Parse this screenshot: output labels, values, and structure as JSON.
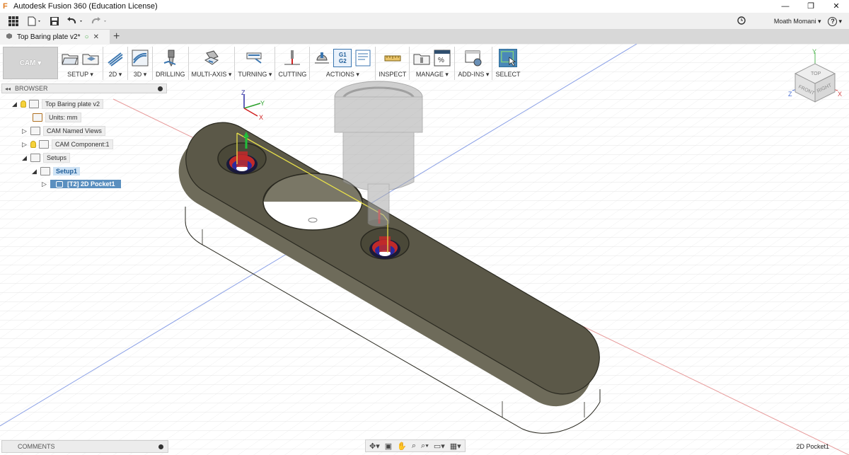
{
  "window": {
    "title": "Autodesk Fusion 360 (Education License)",
    "minimize": "—",
    "restore": "❐",
    "close": "✕"
  },
  "quick_access": {
    "user": "Moath Momani",
    "help": "?"
  },
  "document_tab": {
    "title": "Top Baring plate v2*"
  },
  "workspace": {
    "label": "CAM ▾"
  },
  "ribbon_groups": [
    {
      "id": "setup",
      "label": "SETUP ▾"
    },
    {
      "id": "2d",
      "label": "2D ▾"
    },
    {
      "id": "3d",
      "label": "3D ▾"
    },
    {
      "id": "drilling",
      "label": "DRILLING"
    },
    {
      "id": "multiaxis",
      "label": "MULTI-AXIS ▾"
    },
    {
      "id": "turning",
      "label": "TURNING ▾"
    },
    {
      "id": "cutting",
      "label": "CUTTING"
    },
    {
      "id": "actions",
      "label": "ACTIONS ▾"
    },
    {
      "id": "inspect",
      "label": "INSPECT"
    },
    {
      "id": "manage",
      "label": "MANAGE ▾"
    },
    {
      "id": "addins",
      "label": "ADD-INS ▾"
    },
    {
      "id": "select",
      "label": "SELECT"
    }
  ],
  "actions_g_code": {
    "line1": "G1",
    "line2": "G2"
  },
  "browser": {
    "header": "BROWSER",
    "items": [
      {
        "label": "Top Baring plate v2"
      },
      {
        "label": "Units: mm"
      },
      {
        "label": "CAM Named Views"
      },
      {
        "label": "CAM Component:1"
      },
      {
        "label": "Setups"
      },
      {
        "label": "Setup1"
      },
      {
        "label": "[T2] 2D Pocket1"
      }
    ]
  },
  "triad": {
    "x": "X",
    "y": "Y",
    "z": "Z"
  },
  "viewcube": {
    "top": "TOP",
    "front": "FRONT",
    "right": "RIGHT",
    "x": "X",
    "y": "Y",
    "z": "Z"
  },
  "comments": {
    "label": "COMMENTS"
  },
  "status": {
    "text": "2D Pocket1"
  },
  "colors": {
    "plate": "#5b5848",
    "plate_side": "#6e6b5a",
    "toolpath": "#e8e04a",
    "ribbon_accent": "#4a88b8"
  }
}
